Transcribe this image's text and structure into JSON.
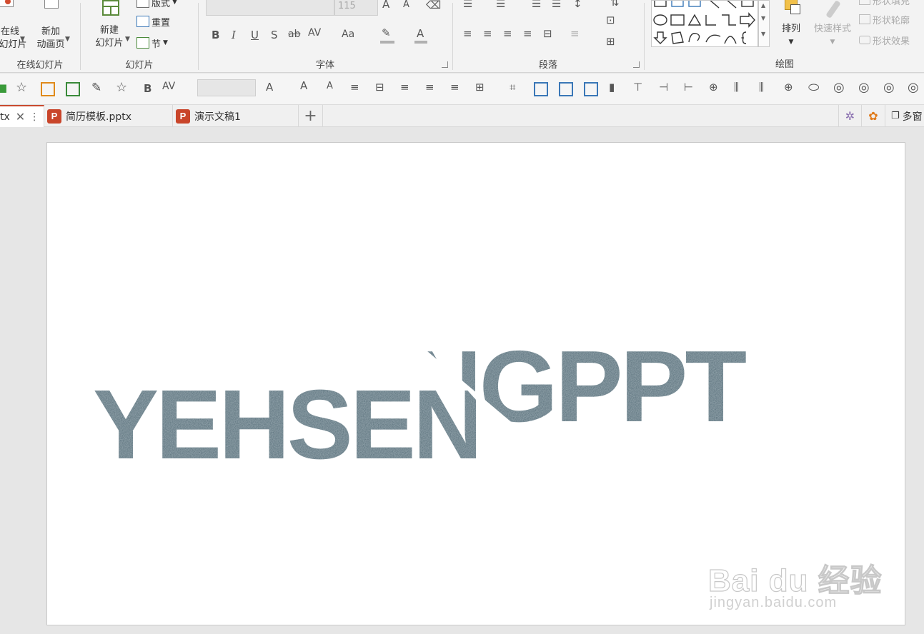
{
  "ribbon": {
    "group_online": {
      "btn_online_slide_lines": [
        "在线",
        "幻灯片"
      ],
      "btn_new_animation_lines": [
        "新加",
        "动画页"
      ],
      "label": "在线幻灯片"
    },
    "group_slides": {
      "new_slide_lines": [
        "新建",
        "幻灯片"
      ],
      "layout": "版式",
      "reset": "重置",
      "section": "节",
      "label": "幻灯片"
    },
    "group_font": {
      "font_size": "115",
      "bold": "B",
      "italic": "I",
      "underline": "U",
      "shadow": "S",
      "strike": "ab",
      "spacing": "AV",
      "change_case": "Aa",
      "font_color": "A",
      "grow": "A",
      "shrink": "A",
      "label": "字体"
    },
    "group_paragraph": {
      "label": "段落"
    },
    "group_drawing": {
      "arrange": "排列",
      "quick_styles": "快速样式",
      "shape_fill": "形状填充",
      "shape_outline": "形状轮廓",
      "shape_effects": "形状效果",
      "label": "绘图"
    }
  },
  "quickbar": {
    "bold": "B",
    "spacing": "AV"
  },
  "tabs": [
    {
      "label": "tx",
      "active": true
    },
    {
      "label": "简历模板.pptx",
      "active": false
    },
    {
      "label": "演示文稿1",
      "active": false
    }
  ],
  "tab_icon_letter": "P",
  "add_tab": "+",
  "window_btn": "多窗",
  "slide": {
    "wordart_left": "YEHSEN",
    "wordart_right": "NGPPT",
    "text_color": "#47646f"
  },
  "watermark": {
    "brand": "Bai du 经验",
    "url": "jingyan.baidu.com"
  }
}
